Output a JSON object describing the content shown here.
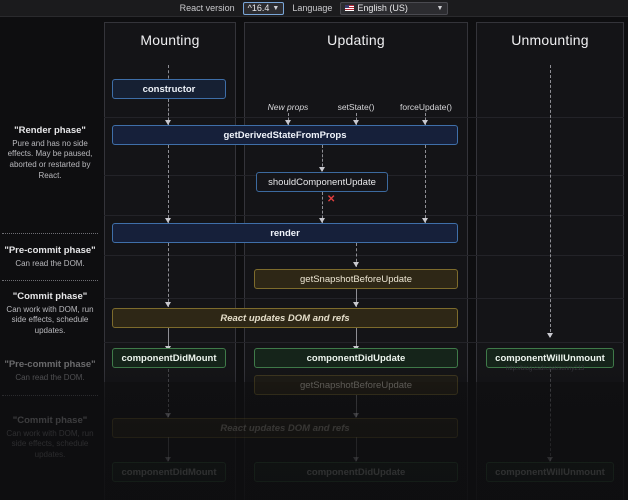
{
  "topbar": {
    "version_label": "React version",
    "version_value": "^16.4",
    "language_label": "Language",
    "language_value": "English (US)",
    "caret": "▼"
  },
  "legend": [
    {
      "title": "\"Render phase\"",
      "desc": "Pure and has no side effects. May be paused, aborted or restarted by React."
    },
    {
      "title": "\"Pre-commit phase\"",
      "desc": "Can read the DOM."
    },
    {
      "title": "\"Commit phase\"",
      "desc": "Can work with DOM, run side effects, schedule updates."
    }
  ],
  "legend_faded": [
    {
      "title": "\"Pre-commit phase\"",
      "desc": "Can read the DOM."
    },
    {
      "title": "\"Commit phase\"",
      "desc": "Can work with DOM, run side effects, schedule updates."
    }
  ],
  "columns": {
    "mounting": "Mounting",
    "updating": "Updating",
    "unmounting": "Unmounting"
  },
  "triggers": {
    "new_props": "New props",
    "set_state": "setState()",
    "force_update": "forceUpdate()"
  },
  "boxes": {
    "constructor": "constructor",
    "get_derived_state": "getDerivedStateFromProps",
    "should_component_update": "shouldComponentUpdate",
    "render": "render",
    "get_snapshot": "getSnapshotBeforeUpdate",
    "react_updates": "React updates DOM and refs",
    "did_mount": "componentDidMount",
    "did_update": "componentDidUpdate",
    "will_unmount": "componentWillUnmount"
  },
  "marks": {
    "abort_x": "✕"
  },
  "watermark": "http://blog.csdn.net/sunny213",
  "colors": {
    "blue_border": "#3e6ea8",
    "blue_fill": "#16203a",
    "olive_border": "#7d6b2c",
    "olive_fill": "#2e2716",
    "green_border": "#3f7a49",
    "green_fill": "#15241a",
    "abort_red": "#e03e3e",
    "background": "#0e0e10"
  }
}
